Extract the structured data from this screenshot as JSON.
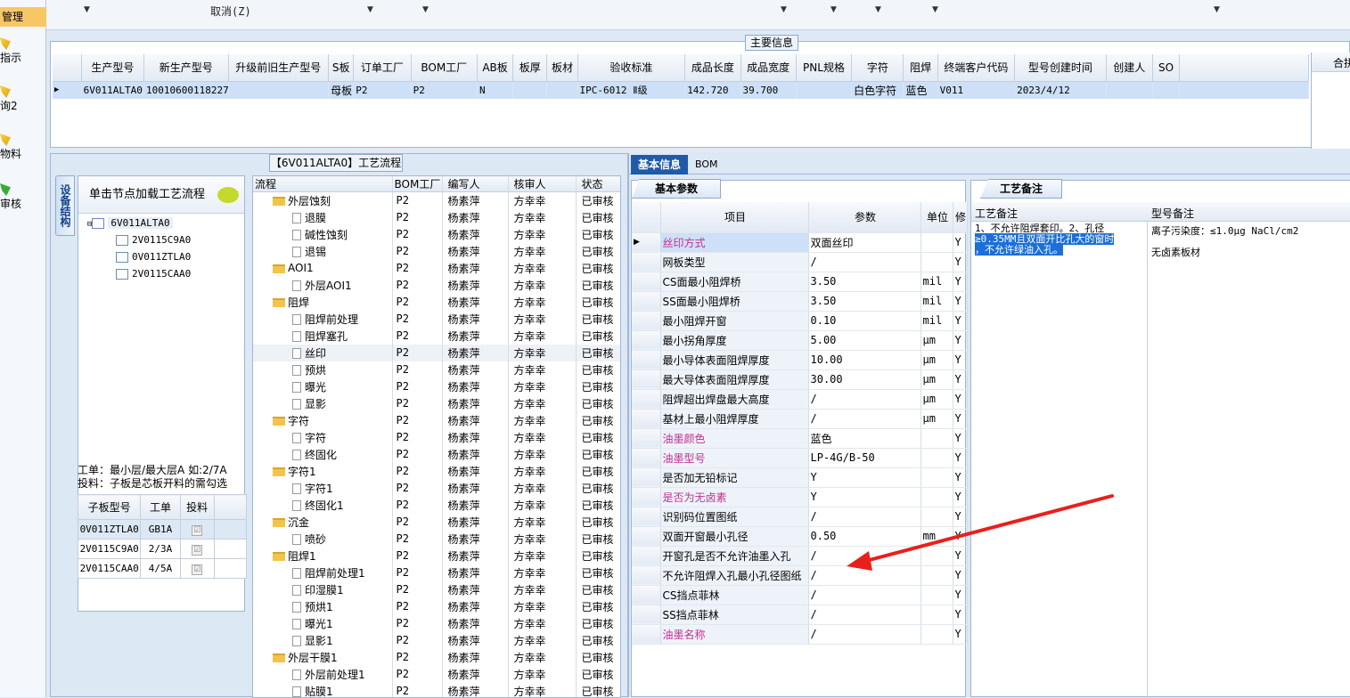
{
  "leftnav": {
    "header": "管理",
    "items": [
      "指示",
      "询2",
      "物料",
      "审核"
    ]
  },
  "topbar": {
    "cancel": "取消(Z)"
  },
  "main": {
    "title": "主要信息",
    "columns": [
      "生产型号",
      "新生产型号",
      "升级前旧生产型号",
      "S板",
      "订单工厂",
      "BOM工厂",
      "AB板",
      "板厚",
      "板材",
      "验收标准",
      "成品长度",
      "成品宽度",
      "PNL规格",
      "字符",
      "阻焊",
      "终端客户代码",
      "型号创建时间",
      "创建人",
      "SO"
    ],
    "row": [
      "6V011ALTA0",
      "10010600118227",
      "",
      "母板",
      "P2",
      "P2",
      "N",
      "",
      "",
      "IPC-6012 Ⅱ级",
      "142.720",
      "39.700",
      "",
      "白色字符",
      "蓝色",
      "V011",
      "2023/4/12",
      "",
      ""
    ],
    "side_label": "合拼"
  },
  "flow": {
    "title": "【6V011ALTA0】工艺流程",
    "vtab": "设备结构",
    "tree_header": "单击节点加载工艺流程",
    "tree": [
      "6V011ALTA0",
      "2V0115C9A0",
      "0V011ZTLA0",
      "2V0115CAA0"
    ],
    "note1": "工单：最小层/最大层A 如:2/7A",
    "note2": "投料：子板是芯板开料的需勾选",
    "sub_columns": [
      "子板型号",
      "工单",
      "投料"
    ],
    "sub_rows": [
      [
        "0V011ZTLA0",
        "GB1A",
        "☑"
      ],
      [
        "2V0115C9A0",
        "2/3A",
        "☑"
      ],
      [
        "2V0115CAA0",
        "4/5A",
        "☑"
      ]
    ],
    "columns": [
      "流程",
      "BOM工厂",
      "编写人",
      "核审人",
      "状态"
    ],
    "rows": [
      {
        "name": "外层蚀刻",
        "folder": true,
        "f": "P2",
        "w": "杨素萍",
        "r": "方幸幸",
        "s": "已审核"
      },
      {
        "name": "退膜",
        "folder": false,
        "f": "P2",
        "w": "杨素萍",
        "r": "方幸幸",
        "s": "已审核"
      },
      {
        "name": "碱性蚀刻",
        "folder": false,
        "f": "P2",
        "w": "杨素萍",
        "r": "方幸幸",
        "s": "已审核"
      },
      {
        "name": "退锡",
        "folder": false,
        "f": "P2",
        "w": "杨素萍",
        "r": "方幸幸",
        "s": "已审核"
      },
      {
        "name": "AOI1",
        "folder": true,
        "f": "P2",
        "w": "杨素萍",
        "r": "方幸幸",
        "s": "已审核"
      },
      {
        "name": "外层AOI1",
        "folder": false,
        "f": "P2",
        "w": "杨素萍",
        "r": "方幸幸",
        "s": "已审核"
      },
      {
        "name": "阻焊",
        "folder": true,
        "f": "P2",
        "w": "杨素萍",
        "r": "方幸幸",
        "s": "已审核"
      },
      {
        "name": "阻焊前处理",
        "folder": false,
        "f": "P2",
        "w": "杨素萍",
        "r": "方幸幸",
        "s": "已审核"
      },
      {
        "name": "阻焊塞孔",
        "folder": false,
        "f": "P2",
        "w": "杨素萍",
        "r": "方幸幸",
        "s": "已审核"
      },
      {
        "name": "丝印",
        "folder": false,
        "f": "P2",
        "w": "杨素萍",
        "r": "方幸幸",
        "s": "已审核"
      },
      {
        "name": "预烘",
        "folder": false,
        "f": "P2",
        "w": "杨素萍",
        "r": "方幸幸",
        "s": "已审核"
      },
      {
        "name": "曝光",
        "folder": false,
        "f": "P2",
        "w": "杨素萍",
        "r": "方幸幸",
        "s": "已审核"
      },
      {
        "name": "显影",
        "folder": false,
        "f": "P2",
        "w": "杨素萍",
        "r": "方幸幸",
        "s": "已审核"
      },
      {
        "name": "字符",
        "folder": true,
        "f": "P2",
        "w": "杨素萍",
        "r": "方幸幸",
        "s": "已审核"
      },
      {
        "name": "字符",
        "folder": false,
        "f": "P2",
        "w": "杨素萍",
        "r": "方幸幸",
        "s": "已审核"
      },
      {
        "name": "终固化",
        "folder": false,
        "f": "P2",
        "w": "杨素萍",
        "r": "方幸幸",
        "s": "已审核"
      },
      {
        "name": "字符1",
        "folder": true,
        "f": "P2",
        "w": "杨素萍",
        "r": "方幸幸",
        "s": "已审核"
      },
      {
        "name": "字符1",
        "folder": false,
        "f": "P2",
        "w": "杨素萍",
        "r": "方幸幸",
        "s": "已审核"
      },
      {
        "name": "终固化1",
        "folder": false,
        "f": "P2",
        "w": "杨素萍",
        "r": "方幸幸",
        "s": "已审核"
      },
      {
        "name": "沉金",
        "folder": true,
        "f": "P2",
        "w": "杨素萍",
        "r": "方幸幸",
        "s": "已审核"
      },
      {
        "name": "喷砂",
        "folder": false,
        "f": "P2",
        "w": "杨素萍",
        "r": "方幸幸",
        "s": "已审核"
      },
      {
        "name": "阻焊1",
        "folder": true,
        "f": "P2",
        "w": "杨素萍",
        "r": "方幸幸",
        "s": "已审核"
      },
      {
        "name": "阻焊前处理1",
        "folder": false,
        "f": "P2",
        "w": "杨素萍",
        "r": "方幸幸",
        "s": "已审核"
      },
      {
        "name": "印湿膜1",
        "folder": false,
        "f": "P2",
        "w": "杨素萍",
        "r": "方幸幸",
        "s": "已审核"
      },
      {
        "name": "预烘1",
        "folder": false,
        "f": "P2",
        "w": "杨素萍",
        "r": "方幸幸",
        "s": "已审核"
      },
      {
        "name": "曝光1",
        "folder": false,
        "f": "P2",
        "w": "杨素萍",
        "r": "方幸幸",
        "s": "已审核"
      },
      {
        "name": "显影1",
        "folder": false,
        "f": "P2",
        "w": "杨素萍",
        "r": "方幸幸",
        "s": "已审核"
      },
      {
        "name": "外层干膜1",
        "folder": true,
        "f": "P2",
        "w": "杨素萍",
        "r": "方幸幸",
        "s": "已审核"
      },
      {
        "name": "外层前处理1",
        "folder": false,
        "f": "P2",
        "w": "杨素萍",
        "r": "方幸幸",
        "s": "已审核"
      },
      {
        "name": "贴膜1",
        "folder": false,
        "f": "P2",
        "w": "杨素萍",
        "r": "方幸幸",
        "s": "已审核"
      }
    ]
  },
  "right": {
    "tab_active": "基本信息",
    "tab_other": "BOM",
    "basic_tab": "基本参数",
    "param_columns": [
      "项目",
      "参数",
      "单位",
      "修"
    ],
    "params": [
      {
        "item": "丝印方式",
        "val": "双面丝印",
        "unit": "",
        "f": "Y",
        "pink": true
      },
      {
        "item": "网板类型",
        "val": "/",
        "unit": "",
        "f": "Y",
        "pink": false
      },
      {
        "item": "CS面最小阻焊桥",
        "val": "3.50",
        "unit": "mil",
        "f": "Y",
        "pink": false
      },
      {
        "item": "SS面最小阻焊桥",
        "val": "3.50",
        "unit": "mil",
        "f": "Y",
        "pink": false
      },
      {
        "item": "最小阻焊开窗",
        "val": "0.10",
        "unit": "mil",
        "f": "Y",
        "pink": false
      },
      {
        "item": "最小拐角厚度",
        "val": "5.00",
        "unit": "μm",
        "f": "Y",
        "pink": false
      },
      {
        "item": "最小导体表面阻焊厚度",
        "val": "10.00",
        "unit": "μm",
        "f": "Y",
        "pink": false
      },
      {
        "item": "最大导体表面阻焊厚度",
        "val": "30.00",
        "unit": "μm",
        "f": "Y",
        "pink": false
      },
      {
        "item": "阻焊超出焊盘最大高度",
        "val": "/",
        "unit": "μm",
        "f": "Y",
        "pink": false
      },
      {
        "item": "基材上最小阻焊厚度",
        "val": "/",
        "unit": "μm",
        "f": "Y",
        "pink": false
      },
      {
        "item": "油墨颜色",
        "val": "蓝色",
        "unit": "",
        "f": "Y",
        "pink": true
      },
      {
        "item": "油墨型号",
        "val": "LP-4G/B-50",
        "unit": "",
        "f": "Y",
        "pink": true
      },
      {
        "item": "是否加无铅标记",
        "val": "Y",
        "unit": "",
        "f": "Y",
        "pink": false
      },
      {
        "item": "是否为无卤素",
        "val": "Y",
        "unit": "",
        "f": "Y",
        "pink": true
      },
      {
        "item": "识别码位置图纸",
        "val": "/",
        "unit": "",
        "f": "Y",
        "pink": false
      },
      {
        "item": "双面开窗最小孔径",
        "val": "0.50",
        "unit": "mm",
        "f": "Y",
        "pink": false
      },
      {
        "item": "开窗孔是否不允许油墨入孔",
        "val": "/",
        "unit": "",
        "f": "Y",
        "pink": false
      },
      {
        "item": "不允许阻焊入孔最小孔径图纸",
        "val": "/",
        "unit": "",
        "f": "Y",
        "pink": false
      },
      {
        "item": "CS挡点菲林",
        "val": "/",
        "unit": "",
        "f": "Y",
        "pink": false
      },
      {
        "item": "SS挡点菲林",
        "val": "/",
        "unit": "",
        "f": "Y",
        "pink": false
      },
      {
        "item": "油墨名称",
        "val": "/",
        "unit": "",
        "f": "Y",
        "pink": true
      }
    ],
    "process_tab": "工艺备注",
    "process_col1": "工艺备注",
    "process_col2": "型号备注",
    "note_line1": "1、不允许阻焊套印。2、孔径",
    "note_line2": "≥0.35MM且双面开比孔大的窗时",
    "note_line3": "，不允许绿油入孔。",
    "model_note1": "离子污染度：≤1.0μg NaCl/cm2",
    "model_note2": "无卤素板材"
  },
  "colors": {
    "arrow": "#e8201c",
    "accent": "#1f5ba8",
    "pink": "#c1308f",
    "selected_row": "#cde0f7"
  }
}
